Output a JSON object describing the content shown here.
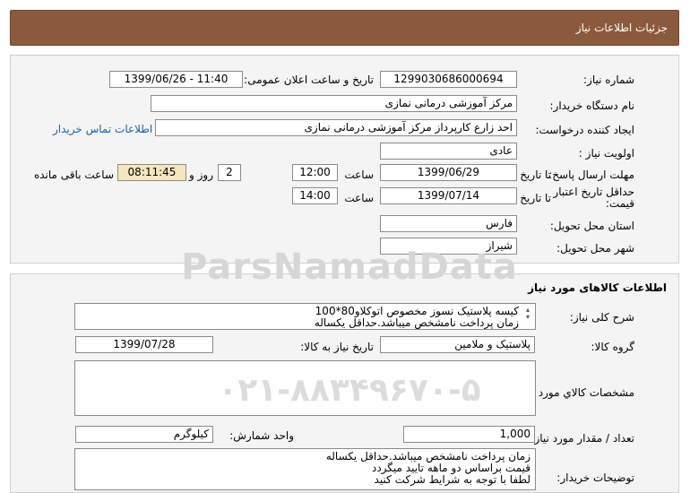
{
  "header": {
    "title": "جزئیات اطلاعات نیاز"
  },
  "details": {
    "need_number_label": "شماره نیاز:",
    "need_number": "1299030686000694",
    "announce_label": "تاریخ و ساعت اعلان عمومی:",
    "announce_value": "1399/06/26 - 11:40",
    "buyer_org_label": "نام دستگاه خریدار:",
    "buyer_org": "مرکز آموزشی درمانی نمازی",
    "requester_label": "ایجاد کننده درخواست:",
    "requester": "احد زارع کارپرداز مرکز آموزشی درمانی نمازی",
    "contact_link": "اطلاعات تماس خریدار",
    "priority_label": "اولویت نیاز :",
    "priority": "عادی",
    "deadline_label": "مهلت ارسال پاسخ:",
    "to_date_label": "تا تاریخ :",
    "deadline_date": "1399/06/29",
    "time_label": "ساعت",
    "deadline_time": "12:00",
    "days_value": "2",
    "days_label": "روز و",
    "remaining_time": "08:11:45",
    "remaining_label": "ساعت باقی مانده",
    "validity_label_1": "حداقل تاریخ اعتبار",
    "validity_label_2": "قیمت:",
    "validity_date": "1399/07/14",
    "validity_time": "14:00",
    "province_label": "استان محل تحویل:",
    "province": "فارس",
    "city_label": "شهر محل تحویل:",
    "city": "شیراز"
  },
  "watermark": {
    "line1": "ParsNamadData",
    "line2": "۰۲۱-۸۸۳۴۹۶۷۰-۵"
  },
  "goods": {
    "section_title": "اطلاعات کالاهای مورد نیاز",
    "summary_label": "شرح کلی نیاز:",
    "summary_lines": [
      "کیسه پلاستیک نسوز مخصوص اتوکلاو80*100",
      "زمان پرداخت نامشخص میباشد.حداقل یکساله"
    ],
    "group_label": "گروه کالا:",
    "group": "پلاستیک و ملامین",
    "need_date_label": "تاریخ نیاز به کالا:",
    "need_date": "1399/07/28",
    "specs_label": "مشخصات کالاي مورد نياز:",
    "quantity_label": "تعداد / مقدار مورد نیاز:",
    "quantity": "1,000",
    "unit_label": "واحد شمارش:",
    "unit": "کیلوگرم",
    "buyer_notes_label": "توضیحات خریدار:",
    "buyer_notes_lines": [
      "زمان پرداخت نامشخص میباشد.حداقل یکساله",
      "قیمت براساس دو ماهه تایید میگردد",
      "لطفا با توجه به شرایط شرکت کنید"
    ]
  }
}
